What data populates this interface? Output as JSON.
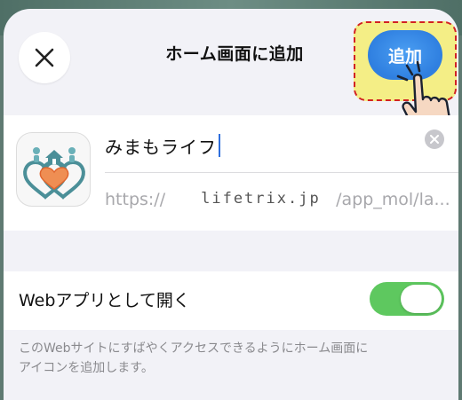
{
  "header": {
    "title": "ホーム画面に追加",
    "add_label": "追加",
    "close_icon": "close-icon",
    "colors": {
      "accent": "#2f7fe0",
      "highlight": "#f4ee86",
      "highlight_border": "#d22222"
    }
  },
  "shortcut": {
    "name_value": "みまもライフ",
    "url_prefix": "https://",
    "url_domain": "lifetrix.jp",
    "url_suffix": "/app_mol/la...",
    "icon": "app-heart-house-icon"
  },
  "webapp": {
    "label": "Webアプリとして開く",
    "toggle_on": true,
    "toggle_color": "#5ec85f"
  },
  "description": {
    "line1": "このWebサイトにすばやくアクセスできるようにホーム画面に",
    "line2": "アイコンを追加します。"
  }
}
